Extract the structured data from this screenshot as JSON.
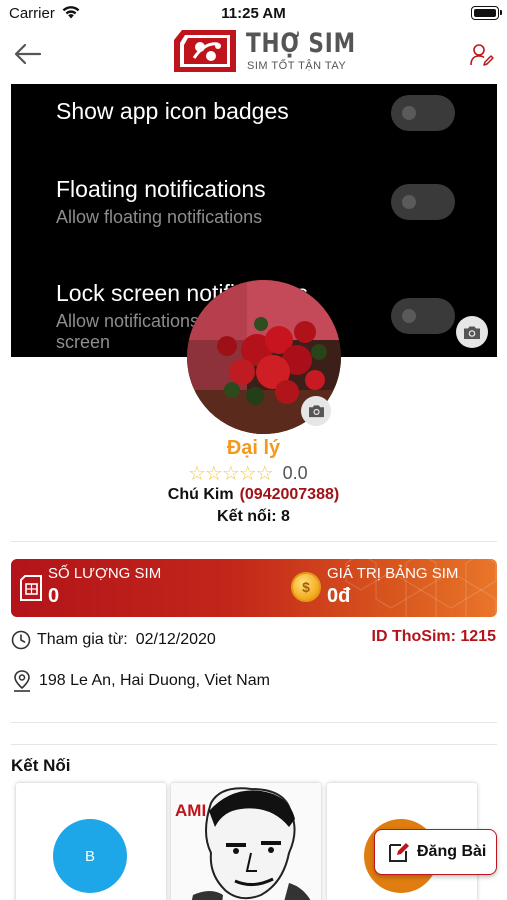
{
  "status_bar": {
    "carrier": "Carrier",
    "time": "11:25 AM"
  },
  "header": {
    "logo_name": "THỢ SIM",
    "logo_tagline": "SIM TỐT TẬN TAY",
    "back_icon": "arrow-left-icon",
    "user_icon": "user-edit-icon"
  },
  "cover": {
    "rows": [
      {
        "title": "Show app icon badges",
        "subtitle": ""
      },
      {
        "title": "Floating notifications",
        "subtitle": "Allow floating notifications"
      },
      {
        "title": "Lock screen notifications",
        "subtitle": "Allow notifications",
        "subtitle2": "screen"
      }
    ]
  },
  "profile": {
    "role": "Đại lý",
    "rating": "0.0",
    "stars": "☆☆☆☆☆",
    "name": "Chú Kim",
    "phone": "(0942007388)",
    "connections_label": "Kết nối:",
    "connections_count": "8"
  },
  "stats": {
    "sim_count_label": "SỐ LƯỢNG SIM",
    "sim_count_value": "0",
    "sim_value_label": "GIÁ TRỊ BẢNG SIM",
    "sim_value_value": "0đ"
  },
  "info": {
    "joined_label": "Tham gia từ:",
    "joined_date": "02/12/2020",
    "thosim_id": "ID ThoSim: 1215",
    "address": "198 Le An, Hai Duong, Viet Nam"
  },
  "connections_section": {
    "title": "Kết Nối",
    "cards": [
      {
        "initial": "B"
      },
      {
        "caption": "AMI"
      },
      {
        "initial": ""
      }
    ]
  },
  "fab": {
    "label": "Đăng Bài"
  },
  "colors": {
    "brand_red": "#b3141a",
    "accent_orange": "#f39a1e",
    "avatar_blue": "#1ea7e8"
  }
}
